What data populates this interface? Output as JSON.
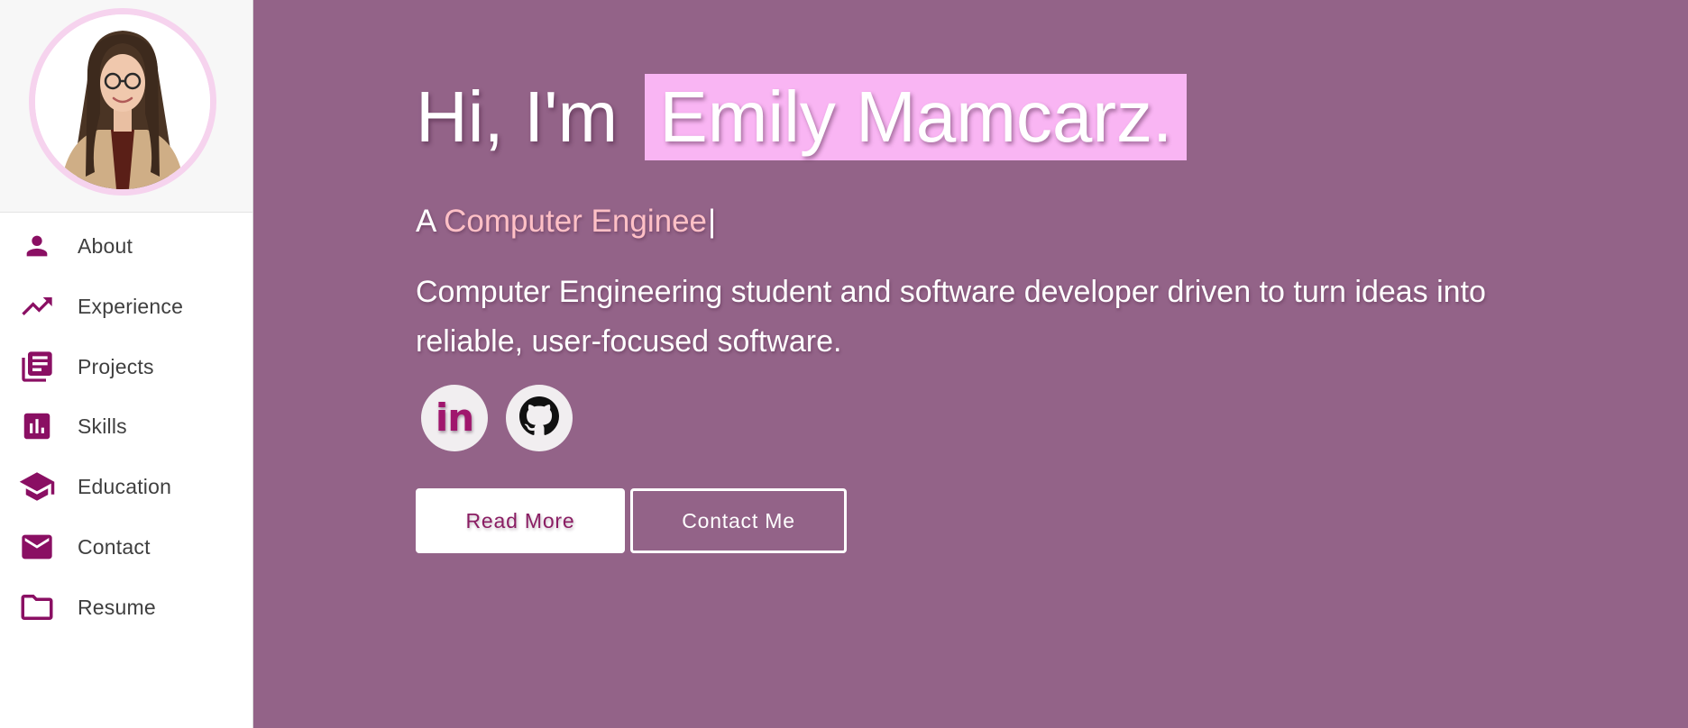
{
  "colors": {
    "hero_background": "#936388",
    "sidebar_background": "#ffffff",
    "accent": "#8a0f63",
    "name_highlight": "#f9b5f3",
    "typed_role": "#ffc0c6",
    "avatar_ring": "#f6d3ee"
  },
  "sidebar": {
    "items": [
      {
        "label": "About",
        "icon": "person-icon"
      },
      {
        "label": "Experience",
        "icon": "trending-up-icon"
      },
      {
        "label": "Projects",
        "icon": "library-books-icon"
      },
      {
        "label": "Skills",
        "icon": "bar-chart-icon"
      },
      {
        "label": "Education",
        "icon": "graduation-cap-icon"
      },
      {
        "label": "Contact",
        "icon": "mail-icon"
      },
      {
        "label": "Resume",
        "icon": "folder-icon"
      }
    ]
  },
  "hero": {
    "greeting": "Hi, I'm",
    "name": "Emily Mamcarz.",
    "typed_prefix": "A",
    "typed_role": "Computer Enginee",
    "caret": "|",
    "bio": "Computer Engineering student and software developer driven to turn ideas into reliable, user-focused software.",
    "social": [
      {
        "label": "in",
        "icon": "linkedin-icon"
      },
      {
        "label": "",
        "icon": "github-icon"
      }
    ],
    "buttons": {
      "read_more": "Read More",
      "contact_me": "Contact Me"
    }
  }
}
